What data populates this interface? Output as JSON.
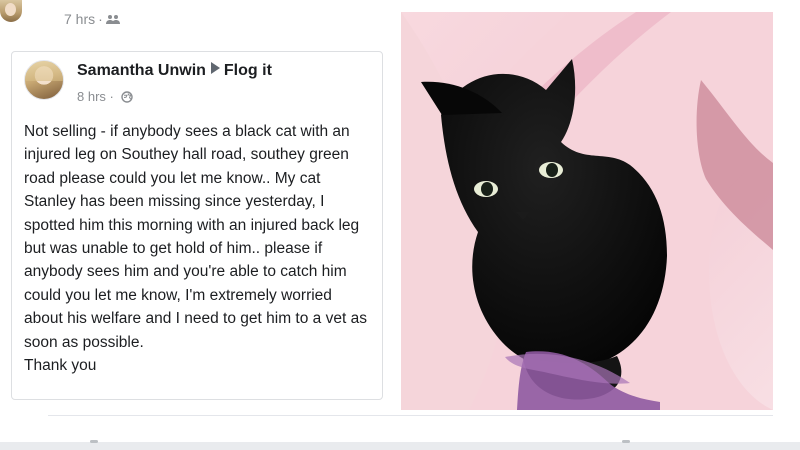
{
  "outer_post": {
    "time": "7 hrs",
    "separator": "·",
    "audience_icon": "friends-icon"
  },
  "shared_post": {
    "author": "Samantha Unwin",
    "group": "Flog it",
    "time": "8 hrs",
    "separator": "·",
    "audience_icon": "globe-icon",
    "text": "Not selling - if anybody sees a black cat with an injured leg on Southey hall road, southey green road please could you let me know.. My cat Stanley has been missing since yesterday, I spotted him this morning with an injured back leg but was unable to get hold of him.. please if anybody sees him and you're able to catch him could you let me know, I'm extremely worried about his welfare and I need to get him to a vet as soon as possible.",
    "closing": "Thank you"
  },
  "photo": {
    "subject": "black cat photo"
  },
  "colors": {
    "text": "#1c1e21",
    "meta": "#8a8d91",
    "border": "#dddfe2",
    "photo_background": "#f3cfd6"
  }
}
